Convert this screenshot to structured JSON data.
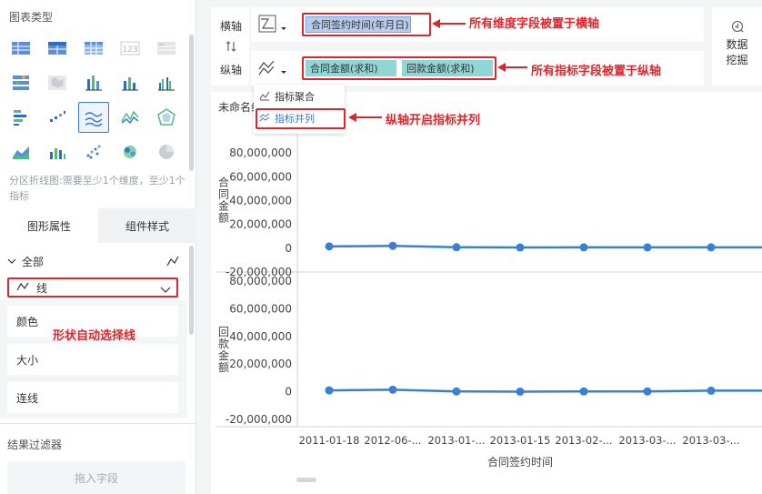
{
  "left_panel": {
    "chart_type_title": "图表类型",
    "chart_type_hint": "分区折线图:需要至少1个维度，至少1个指标",
    "tabs": [
      {
        "label": "图形属性",
        "active": true
      },
      {
        "label": "组件样式",
        "active": false
      }
    ],
    "all_label": "全部",
    "shape_value": "线",
    "props": [
      "颜色",
      "大小",
      "连线"
    ],
    "filter_title": "结果过滤器",
    "drop_placeholder": "拖入字段"
  },
  "config": {
    "x_axis_label": "横轴",
    "y_axis_label": "纵轴",
    "x_fields": [
      "合同签约时间(年月日)"
    ],
    "y_fields": [
      "合同金额(求和)",
      "回款金额(求和)"
    ],
    "dropdown_items": [
      "指标聚合",
      "指标并列"
    ],
    "data_mining_label": "数据挖掘"
  },
  "annotations": {
    "x_axis_note": "所有维度字段被置于横轴",
    "y_axis_note": "所有指标字段被置于纵轴",
    "parallel_note": "纵轴开启指标并列",
    "shape_note": "形状自动选择线"
  },
  "colors": {
    "accent": "#3a78d6",
    "annotation_red": "#e0242a",
    "line": "#3b7fd4",
    "pill_blue": "#b8cdee",
    "pill_teal": "#8fd6d4"
  },
  "chart_title": "未命名组",
  "chart_data": {
    "type": "line",
    "xlabel": "合同签约时间",
    "categories": [
      "2011-01-18",
      "2012-06-...",
      "2013-01-...",
      "2013-01-15",
      "2013-02-...",
      "2013-03-...",
      "2013-03-..."
    ],
    "panels": [
      {
        "ylabel": "合同金额",
        "ylim": [
          -20000000,
          100000000
        ],
        "yticks": [
          "100,0",
          "80,000,000",
          "60,000,000",
          "40,000,000",
          "20,000,000",
          "0",
          "-20,000,000"
        ],
        "tick_values": [
          100000000,
          80000000,
          60000000,
          40000000,
          20000000,
          0,
          -20000000
        ],
        "series": [
          {
            "name": "合同金额(求和)",
            "values": [
              1500000,
              2000000,
              800000,
              600000,
              700000,
              700000,
              700000
            ]
          }
        ]
      },
      {
        "ylabel": "回款金额",
        "ylim": [
          -20000000,
          80000000
        ],
        "yticks": [
          "80,000,000",
          "60,000,000",
          "40,000,000",
          "20,000,000",
          "0",
          "-20,000,000"
        ],
        "tick_values": [
          80000000,
          60000000,
          40000000,
          20000000,
          0,
          -20000000
        ],
        "series": [
          {
            "name": "回款金额(求和)",
            "values": [
              1000000,
              1500000,
              200000,
              100000,
              200000,
              200000,
              800000
            ]
          }
        ]
      }
    ]
  }
}
